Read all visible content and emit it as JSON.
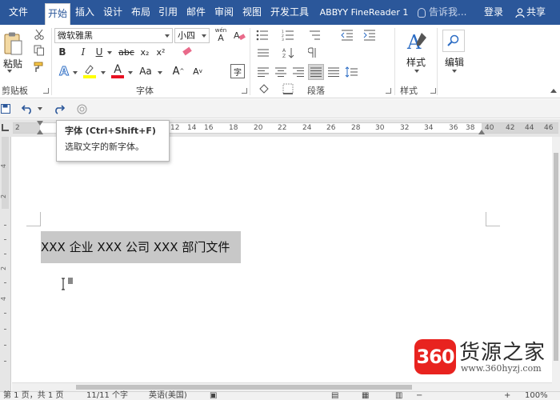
{
  "tabs": [
    {
      "label": "文件",
      "active": false
    },
    {
      "label": "开始",
      "active": true
    },
    {
      "label": "插入",
      "active": false
    },
    {
      "label": "设计",
      "active": false
    },
    {
      "label": "布局",
      "active": false
    },
    {
      "label": "引用",
      "active": false
    },
    {
      "label": "邮件",
      "active": false
    },
    {
      "label": "审阅",
      "active": false
    },
    {
      "label": "视图",
      "active": false
    },
    {
      "label": "开发工具",
      "active": false
    },
    {
      "label": "ABBYY FineReader 1",
      "active": false
    }
  ],
  "tell_me": "告诉我...",
  "login": "登录",
  "share": "共享",
  "ribbon": {
    "clipboard": {
      "paste": "粘贴",
      "label": "剪贴板"
    },
    "font": {
      "name": "微软雅黑",
      "size": "小四",
      "wen": "wén",
      "wen_char": "A",
      "label": "字体",
      "bold": "B",
      "italic": "I",
      "underline": "U",
      "strike": "abc",
      "sub": "x₂",
      "sup": "x²",
      "effects": "A",
      "color_a": "A",
      "size_aa": "Aa",
      "grow": "A",
      "shrink": "A",
      "char_border": "字"
    },
    "paragraph": {
      "label": "段落"
    },
    "styles": {
      "button": "样式",
      "label": "样式"
    },
    "editing": {
      "button": "编辑"
    }
  },
  "ruler": {
    "labels": [
      "2",
      "12",
      "14",
      "16",
      "18",
      "20",
      "22",
      "24",
      "26",
      "28",
      "30",
      "32",
      "34",
      "36",
      "38",
      "40",
      "42",
      "44",
      "46"
    ]
  },
  "vruler": {
    "labels": [
      "4",
      "2",
      "2",
      "4"
    ]
  },
  "tooltip": {
    "title": "字体 (Ctrl+Shift+F)",
    "description": "选取文字的新字体。"
  },
  "document": {
    "text": "XXX 企业 XXX 公司 XXX 部门文件"
  },
  "status": {
    "page": "第 1 页，共 1 页",
    "words": "11/11 个字",
    "language": "英语(美国)",
    "zoom": "100%"
  },
  "watermark": {
    "badge": "360",
    "name": "货源之家",
    "url": "www.360hyzj.com"
  },
  "colors": {
    "tabbar": "#2b579a",
    "highlight": "#ffff00",
    "font_color": "#e81123",
    "selection": "#c8c8c8",
    "watermark_red": "#e8231f"
  }
}
